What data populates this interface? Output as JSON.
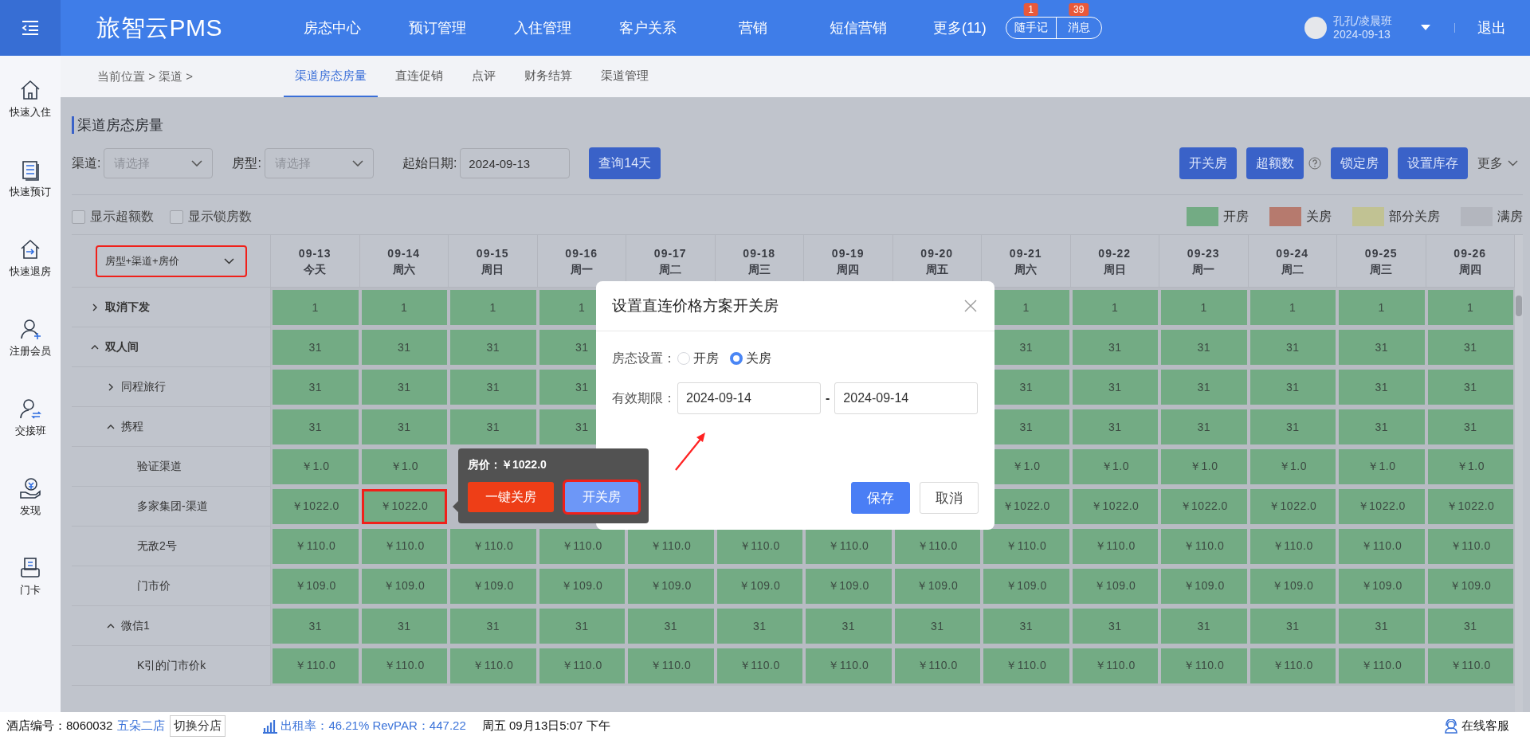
{
  "header": {
    "logo": "旅智云PMS",
    "nav": [
      "房态中心",
      "预订管理",
      "入住管理",
      "客户关系",
      "营销",
      "短信营销",
      "更多(11)"
    ],
    "quick": [
      {
        "label": "随手记",
        "badge": "1"
      },
      {
        "label": "消息",
        "badge": "39"
      }
    ],
    "user": {
      "name": "孔孔/凌晨班",
      "date": "2024-09-13"
    },
    "logout": "退出"
  },
  "sidebar": [
    {
      "label": "快速入住",
      "kind": "checkin"
    },
    {
      "label": "快速预订",
      "kind": "booking"
    },
    {
      "label": "快速退房",
      "kind": "checkout"
    },
    {
      "label": "注册会员",
      "kind": "member"
    },
    {
      "label": "交接班",
      "kind": "shift"
    },
    {
      "label": "发现",
      "kind": "discover"
    },
    {
      "label": "门卡",
      "kind": "card"
    }
  ],
  "subnav": {
    "breadcrumb": "当前位置 > 渠道 >",
    "tabs": [
      {
        "label": "渠道房态房量",
        "selected": true
      },
      {
        "label": "直连促销",
        "selected": false
      },
      {
        "label": "点评",
        "selected": false
      },
      {
        "label": "财务结算",
        "selected": false
      },
      {
        "label": "渠道管理",
        "selected": false
      }
    ]
  },
  "page": {
    "title": "渠道房态房量",
    "filters": [
      {
        "label": "渠道:",
        "placeholder": "请选择",
        "kind": "select"
      },
      {
        "label": "房型:",
        "placeholder": "请选择",
        "kind": "select"
      },
      {
        "label": "起始日期:",
        "value": "2024-09-13",
        "kind": "date"
      }
    ],
    "query_button": "查询14天",
    "actions": [
      {
        "kind": "button",
        "label": "开关房"
      },
      {
        "kind": "button",
        "label": "超额数"
      },
      {
        "kind": "help"
      },
      {
        "kind": "button",
        "label": "锁定房"
      },
      {
        "kind": "button",
        "label": "设置库存"
      }
    ],
    "more": "更多",
    "checkboxes": [
      {
        "label": "显示超额数",
        "checked": false
      },
      {
        "label": "显示锁房数",
        "checked": false
      }
    ],
    "legend": [
      {
        "label": "开房",
        "color": "#73ab84"
      },
      {
        "label": "关房",
        "color": "#b67a6e"
      },
      {
        "label": "部分关房",
        "color": "#c1c293"
      },
      {
        "label": "满房",
        "color": "#b3b6be"
      }
    ]
  },
  "table": {
    "group_select": {
      "value": "房型+渠道+房价",
      "highlighted": true
    },
    "columns": [
      {
        "date": "09-13",
        "day": "今天"
      },
      {
        "date": "09-14",
        "day": "周六"
      },
      {
        "date": "09-15",
        "day": "周日"
      },
      {
        "date": "09-16",
        "day": "周一"
      },
      {
        "date": "09-17",
        "day": "周二"
      },
      {
        "date": "09-18",
        "day": "周三"
      },
      {
        "date": "09-19",
        "day": "周四"
      },
      {
        "date": "09-20",
        "day": "周五"
      },
      {
        "date": "09-21",
        "day": "周六"
      },
      {
        "date": "09-22",
        "day": "周日"
      },
      {
        "date": "09-23",
        "day": "周一"
      },
      {
        "date": "09-24",
        "day": "周二"
      },
      {
        "date": "09-25",
        "day": "周三"
      },
      {
        "date": "09-26",
        "day": "周四"
      }
    ],
    "rows": [
      {
        "name": "取消下发",
        "expanded": false,
        "cells": [
          "1",
          "1",
          "1",
          "1",
          null,
          null,
          null,
          null,
          "1",
          "1",
          "1",
          "1",
          "1",
          "1"
        ]
      },
      {
        "name": "双人间",
        "expanded": true,
        "cells": [
          "31",
          "31",
          "31",
          "31",
          null,
          null,
          null,
          null,
          "31",
          "31",
          "31",
          "31",
          "31",
          "31"
        ],
        "children": [
          {
            "name": "同程旅行",
            "expanded": false,
            "cells": [
              "31",
              "31",
              "31",
              "31",
              null,
              null,
              null,
              null,
              "31",
              "31",
              "31",
              "31",
              "31",
              "31"
            ]
          },
          {
            "name": "携程",
            "expanded": true,
            "cells": [
              "31",
              "31",
              "31",
              "31",
              null,
              null,
              null,
              null,
              "31",
              "31",
              "31",
              "31",
              "31",
              "31"
            ],
            "children": [
              {
                "name": "验证渠道",
                "cells": [
                  "￥1.0",
                  "￥1.0",
                  null,
                  null,
                  null,
                  null,
                  null,
                  null,
                  "￥1.0",
                  "￥1.0",
                  "￥1.0",
                  "￥1.0",
                  "￥1.0",
                  "￥1.0"
                ]
              },
              {
                "name": "多家集团-渠道",
                "cells": [
                  "￥1022.0",
                  {
                    "text": "￥1022.0",
                    "highlighted": true
                  },
                  null,
                  null,
                  null,
                  null,
                  null,
                  null,
                  "￥1022.0",
                  "￥1022.0",
                  "￥1022.0",
                  "￥1022.0",
                  "￥1022.0",
                  "￥1022.0"
                ]
              },
              {
                "name": "无敌2号",
                "cells": [
                  "￥110.0",
                  "￥110.0",
                  "￥110.0",
                  "￥110.0",
                  "￥110.0",
                  "￥110.0",
                  "￥110.0",
                  "￥110.0",
                  "￥110.0",
                  "￥110.0",
                  "￥110.0",
                  "￥110.0",
                  "￥110.0",
                  "￥110.0"
                ]
              },
              {
                "name": "门市价",
                "cells": [
                  "￥109.0",
                  "￥109.0",
                  "￥109.0",
                  "￥109.0",
                  "￥109.0",
                  "￥109.0",
                  "￥109.0",
                  "￥109.0",
                  "￥109.0",
                  "￥109.0",
                  "￥109.0",
                  "￥109.0",
                  "￥109.0",
                  "￥109.0"
                ]
              }
            ]
          },
          {
            "name": "微信1",
            "expanded": true,
            "cells": [
              "31",
              "31",
              "31",
              "31",
              "31",
              "31",
              "31",
              "31",
              "31",
              "31",
              "31",
              "31",
              "31",
              "31"
            ],
            "children": [
              {
                "name": "K引的门市价k",
                "cells": [
                  "￥110.0",
                  "￥110.0",
                  "￥110.0",
                  "￥110.0",
                  "￥110.0",
                  "￥110.0",
                  "￥110.0",
                  "￥110.0",
                  "￥110.0",
                  "￥110.0",
                  "￥110.0",
                  "￥110.0",
                  "￥110.0",
                  "￥110.0"
                ]
              }
            ]
          }
        ]
      }
    ]
  },
  "tooltip": {
    "text": "房价：￥1022.0",
    "buttons": [
      {
        "label": "一键关房",
        "kind": "danger",
        "highlighted": false
      },
      {
        "label": "开关房",
        "kind": "primary",
        "highlighted": true
      }
    ]
  },
  "dialog": {
    "title": "设置直连价格方案开关房",
    "status_label": "房态设置：",
    "options": [
      {
        "label": "开房",
        "selected": false
      },
      {
        "label": "关房",
        "selected": true
      }
    ],
    "period_label": "有效期限：",
    "start": "2024-09-14",
    "separator": "-",
    "end": "2024-09-14",
    "buttons": [
      {
        "label": "保存",
        "kind": "primary"
      },
      {
        "label": "取消",
        "kind": "default"
      }
    ]
  },
  "footer": {
    "hotel_label": "酒店编号：8060032",
    "hotel_name": "五朵二店",
    "switch": "切换分店",
    "stats": "出租率：46.21% RevPAR：447.22",
    "datetime": "周五 09月13日5:07 下午",
    "support": "在线客服"
  }
}
